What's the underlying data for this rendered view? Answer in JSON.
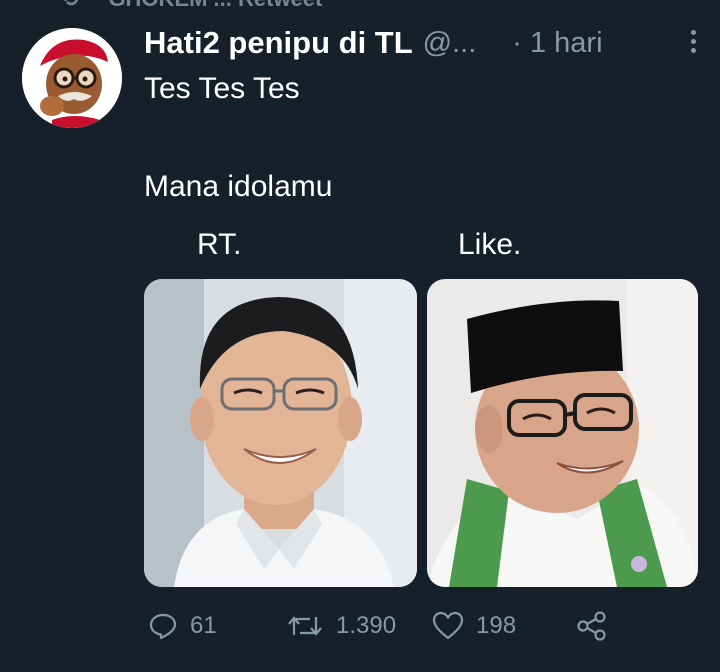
{
  "retweet_banner": {
    "text": "GHOKEM ... Retweet",
    "icon": "retweet-icon"
  },
  "tweet": {
    "author": {
      "display_name": "Hati2 penipu di TL",
      "handle": "@...",
      "avatar": "cartoon-old-man-avatar"
    },
    "separator": "·",
    "timestamp": "1 hari",
    "more_icon": "more-vertical-icon",
    "text_lines": [
      "Tes Tes Tes",
      "Mana idolamu"
    ],
    "media": {
      "labels": [
        "RT.",
        "Like."
      ],
      "panels": [
        {
          "name": "photo-left",
          "label_ref": "RT."
        },
        {
          "name": "photo-right",
          "label_ref": "Like."
        }
      ]
    },
    "actions": {
      "reply": {
        "icon": "reply-icon",
        "count": "61"
      },
      "retweet": {
        "icon": "retweet-icon",
        "count": "1.390"
      },
      "like": {
        "icon": "heart-icon",
        "count": "198"
      },
      "share": {
        "icon": "share-icon"
      }
    }
  },
  "colors": {
    "background": "#15202b",
    "text": "#ffffff",
    "muted": "#8899a6"
  }
}
